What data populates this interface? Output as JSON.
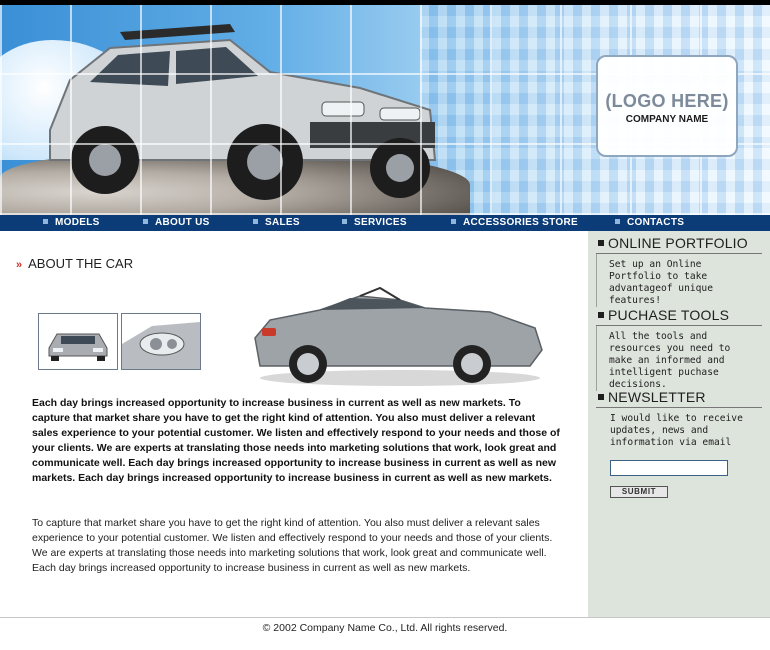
{
  "header": {
    "logo_text": "(LOGO HERE)",
    "company_name": "COMPANY NAME"
  },
  "nav": {
    "items": [
      "MODELS",
      "ABOUT US",
      "SALES",
      "SERVICES",
      "ACCESSORIES STORE",
      "CONTACTS"
    ]
  },
  "main": {
    "heading": "ABOUT THE CAR",
    "paragraph_bold": "Each day brings increased opportunity to increase business in current as well as new markets. To capture that market share you have to get the right kind of attention. You also must deliver a relevant sales experience to your potential customer. We listen and effectively respond to your needs and those of your clients. We are experts at translating those needs into marketing solutions that work, look great and communicate well. Each day brings increased opportunity to increase business in current as well as new markets. Each day brings increased opportunity to increase business in current as well as new markets.",
    "paragraph_normal": "To capture that market share you have to get the right kind of attention. You also must deliver a relevant sales experience to your potential customer. We listen and effectively respond to your needs and those of your clients. We are experts at translating those needs into marketing solutions that work, look great and communicate well. Each day brings increased opportunity to increase business in current as well as new markets."
  },
  "sidebar": {
    "portfolio": {
      "heading": "ONLINE PORTFOLIO",
      "text": "Set up an Online Portfolio to take advantageof unique features!"
    },
    "tools": {
      "heading": "PUCHASE TOOLS",
      "text": "All the tools and resources you need to make an informed and intelligent puchase decisions."
    },
    "newsletter": {
      "heading": "NEWSLETTER",
      "text": "I would like to receive updates, news and information via email",
      "input_value": "",
      "submit_label": "SUBMIT"
    }
  },
  "footer": {
    "copyright": "© 2002 Company Name Co., Ltd. All rights reserved."
  },
  "colors": {
    "nav_bg": "#0b3c78",
    "sidebar_bg": "#dde4dc",
    "accent_arrow": "#d0342c"
  }
}
